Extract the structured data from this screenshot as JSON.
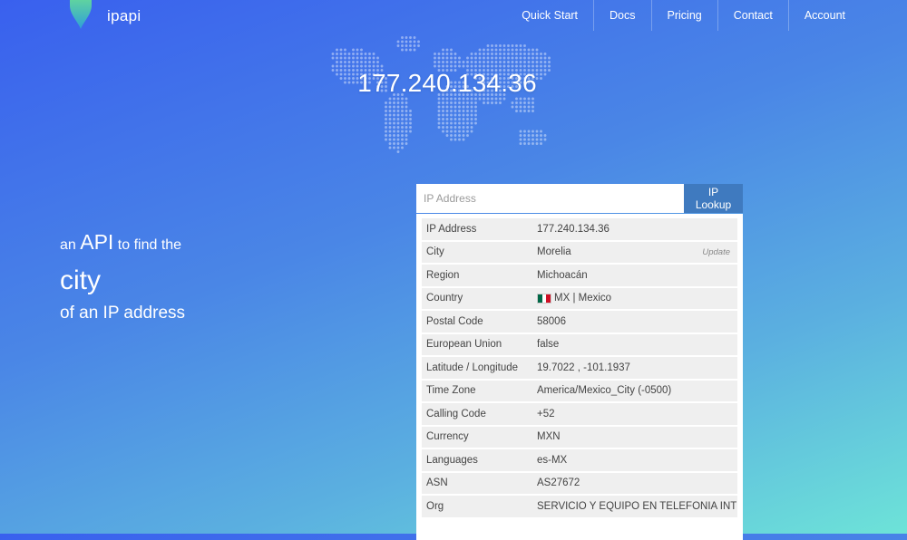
{
  "header": {
    "brand": "ipapi",
    "nav": [
      "Quick Start",
      "Docs",
      "Pricing",
      "Contact",
      "Account"
    ]
  },
  "hero": {
    "ip": "177.240.134.36"
  },
  "tagline": {
    "w1": "an",
    "w2": "API",
    "w3": "to find the",
    "city": "city",
    "line3": "of an IP address"
  },
  "search": {
    "placeholder": "IP Address",
    "button": "IP Lookup"
  },
  "result": {
    "update_label": "Update",
    "rows": [
      {
        "key": "IP Address",
        "value": "177.240.134.36"
      },
      {
        "key": "City",
        "value": "Morelia"
      },
      {
        "key": "Region",
        "value": "Michoacán"
      },
      {
        "key": "Country",
        "value": "MX | Mexico"
      },
      {
        "key": "Postal Code",
        "value": "58006"
      },
      {
        "key": "European Union",
        "value": "false"
      },
      {
        "key": "Latitude / Longitude",
        "value": "19.7022 , -101.1937"
      },
      {
        "key": "Time Zone",
        "value": "America/Mexico_City (-0500)"
      },
      {
        "key": "Calling Code",
        "value": "+52"
      },
      {
        "key": "Currency",
        "value": "MXN"
      },
      {
        "key": "Languages",
        "value": "es-MX"
      },
      {
        "key": "ASN",
        "value": "AS27672"
      },
      {
        "key": "Org",
        "value": "SERVICIO Y EQUIPO EN TELEFONIA INTERNET Y TV S.A. DE C.V."
      }
    ]
  },
  "colors": {
    "button": "#3f7abf",
    "pin_top": "#5fd3a0",
    "pin_bottom": "#2f9fd8",
    "flag": [
      "#006847",
      "#ffffff",
      "#ce1126"
    ]
  },
  "icons": {
    "logo": "map-pin-icon",
    "country_flag": "mexico-flag-icon"
  }
}
